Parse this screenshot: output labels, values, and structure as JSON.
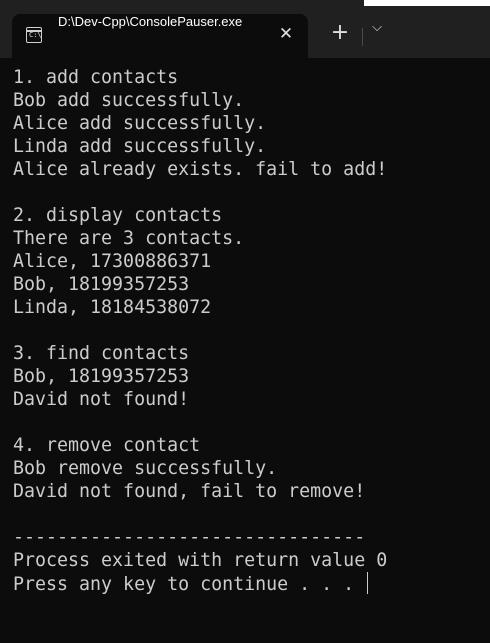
{
  "window": {
    "tab_title": "D:\\Dev-Cpp\\ConsolePauser.exe",
    "tab_icon": "console-app-icon",
    "tab_icon_glyph": "C:\\",
    "close_glyph": "✕",
    "new_tab_glyph": "+",
    "dropdown_glyph": "⌵"
  },
  "console": {
    "lines": [
      "1. add contacts",
      "Bob add successfully.",
      "Alice add successfully.",
      "Linda add successfully.",
      "Alice already exists. fail to add!",
      "",
      "2. display contacts",
      "There are 3 contacts.",
      "Alice, 17300886371",
      "Bob, 18199357253",
      "Linda, 18184538072",
      "",
      "3. find contacts",
      "Bob, 18199357253",
      "David not found!",
      "",
      "4. remove contact",
      "Bob remove successfully.",
      "David not found, fail to remove!",
      "",
      "--------------------------------",
      "Process exited with return value 0",
      "Press any key to continue . . . "
    ]
  },
  "colors": {
    "console_background": "#0c0c0c",
    "console_text": "#cccccc",
    "titlebar_background": "#202020"
  }
}
